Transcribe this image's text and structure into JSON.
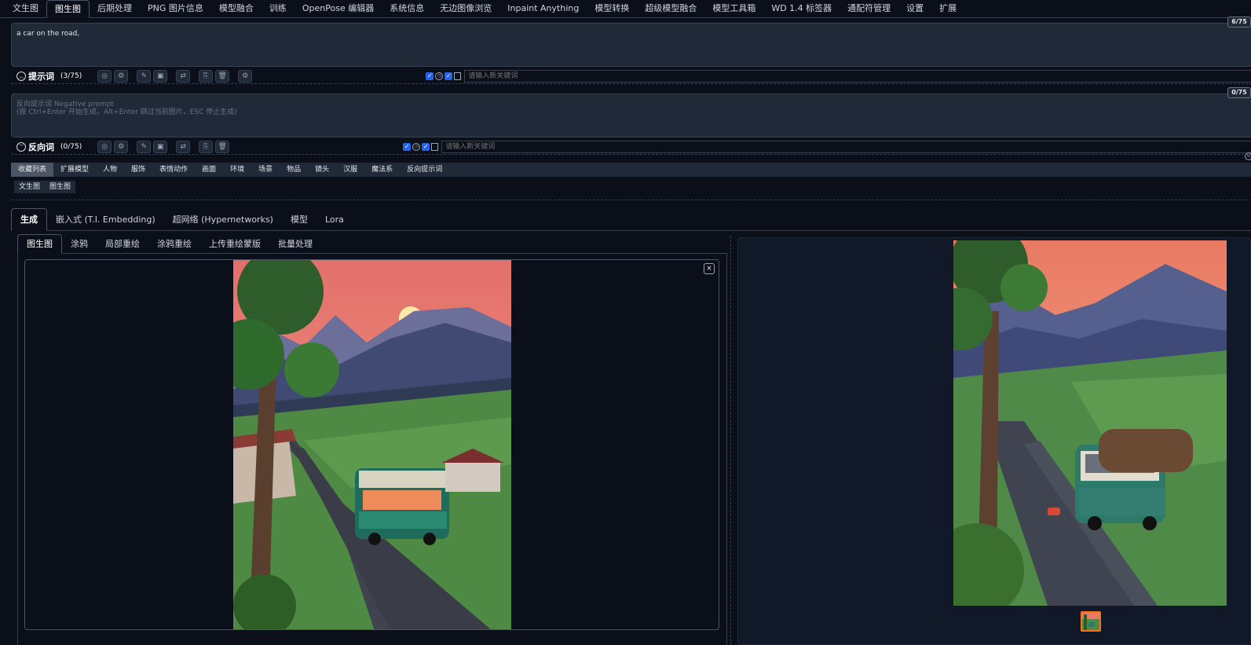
{
  "top_tabs": [
    "文生图",
    "图生图",
    "后期处理",
    "PNG 图片信息",
    "模型融合",
    "训练",
    "OpenPose 编辑器",
    "系统信息",
    "无边图像浏览",
    "Inpaint Anything",
    "模型转换",
    "超级模型融合",
    "模型工具箱",
    "WD 1.4 标签器",
    "通配符管理",
    "设置",
    "扩展"
  ],
  "prompt": {
    "text": "a car on the road,",
    "counter": "6/75",
    "label": "提示词",
    "count": "(3/75)",
    "keyword_placeholder": "请输入新关键词"
  },
  "negative": {
    "placeholder": "反向提示词 Negative prompt\n(按 Ctrl+Enter 开始生成，Alt+Enter 跳过当前图片，ESC 停止生成)",
    "counter": "0/75",
    "label": "反向词",
    "count": "(0/75)",
    "keyword_placeholder": "请输入新关键词"
  },
  "categories": [
    "收藏列表",
    "扩展模型",
    "人物",
    "服饰",
    "表情动作",
    "画面",
    "环境",
    "场景",
    "物品",
    "镜头",
    "汉服",
    "魔法系",
    "反向提示词"
  ],
  "subcategories": [
    "文生图",
    "图生图"
  ],
  "gen_tabs": [
    "生成",
    "嵌入式 (T.I. Embedding)",
    "超网络 (Hypernetworks)",
    "模型",
    "Lora"
  ],
  "img_tabs": [
    "图生图",
    "涂鸦",
    "局部重绘",
    "涂鸦重绘",
    "上传重绘蒙版",
    "批量处理"
  ],
  "icons": {
    "close": "×",
    "collapse_up": "︿",
    "collapse_down": "﹀"
  },
  "colors": {
    "accent_orange": "#f97316",
    "checkbox_blue": "#2563eb",
    "bg": "#0b0f19"
  }
}
